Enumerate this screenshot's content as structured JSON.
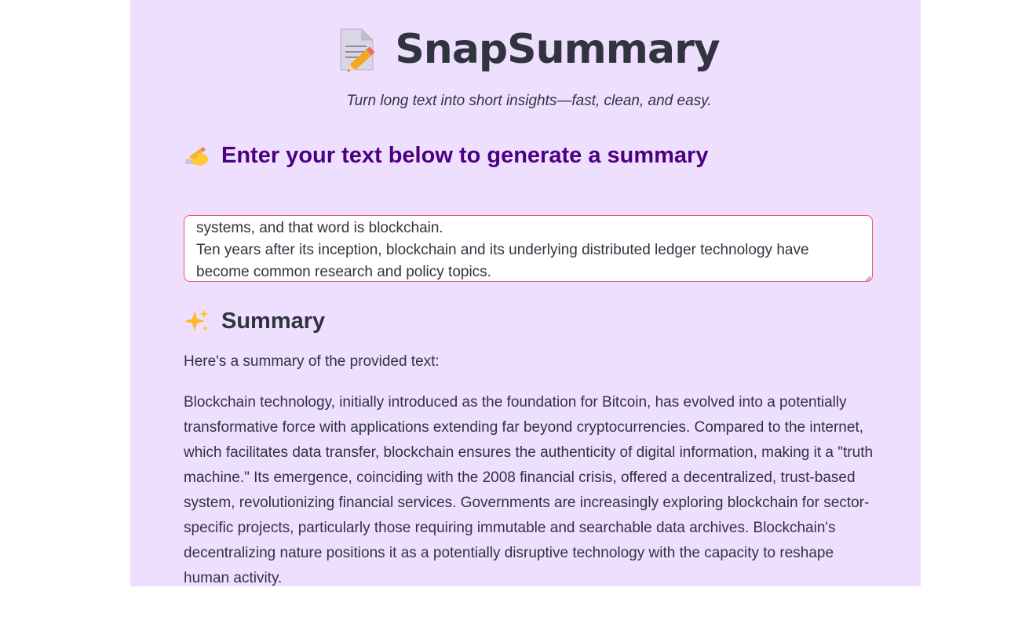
{
  "app": {
    "title": "SnapSummary",
    "subtitle": "Turn long text into short insights—fast, clean, and easy."
  },
  "input_section": {
    "heading": "Enter your text below to generate a summary",
    "textarea_value": "systems, and that word is blockchain.\nTen years after its inception, blockchain and its underlying distributed ledger technology have become common research and policy topics."
  },
  "summary_section": {
    "heading": "Summary",
    "intro": "Here's a summary of the provided text:",
    "body": "Blockchain technology, initially introduced as the foundation for Bitcoin, has evolved into a potentially transformative force with applications extending far beyond cryptocurrencies. Compared to the internet, which facilitates data transfer, blockchain ensures the authenticity of digital information, making it a \"truth machine.\" Its emergence, coinciding with the 2008 financial crisis, offered a decentralized, trust-based system, revolutionizing financial services. Governments are increasingly exploring blockchain for sector-specific projects, particularly those requiring immutable and searchable data archives. Blockchain's decentralizing nature positions it as a potentially disruptive technology with the capacity to reshape human activity."
  },
  "icons": {
    "title_icon": "memo-pencil-icon",
    "input_heading_icon": "writing-hand-icon",
    "summary_heading_icon": "sparkles-icon"
  },
  "colors": {
    "app_background": "#eedfff",
    "input_heading": "#4b0082",
    "textarea_border": "#e8566b",
    "text": "#31333f"
  }
}
